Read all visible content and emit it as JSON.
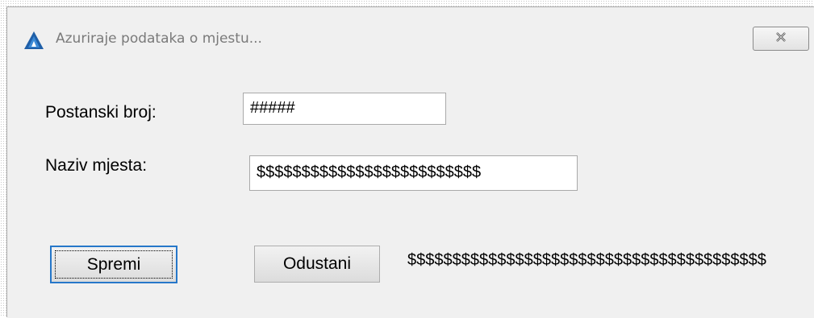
{
  "window": {
    "title": "Azuriraje podataka o mjestu...",
    "icon": "app-triangle-icon",
    "close_icon": "close-icon"
  },
  "form": {
    "postal_code_label": "Postanski broj:",
    "postal_code_value": "#####",
    "place_name_label": "Naziv mjesta:",
    "place_name_value": "$$$$$$$$$$$$$$$$$$$$$$$$$"
  },
  "buttons": {
    "save_label": "Spremi",
    "cancel_label": "Odustani"
  },
  "status": {
    "text": "$$$$$$$$$$$$$$$$$$$$$$$$$$$$$$$$$$$$$$$$"
  },
  "colors": {
    "focus_border": "#2677c9",
    "background": "#f0f0f0"
  }
}
